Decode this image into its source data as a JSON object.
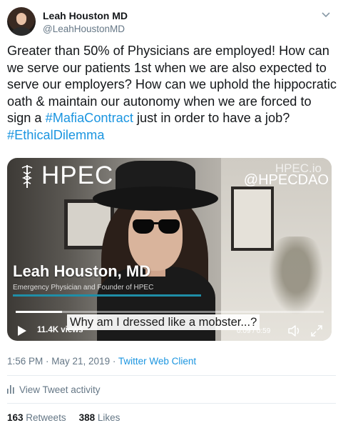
{
  "user": {
    "display_name": "Leah Houston MD",
    "handle": "@LeahHoustonMD",
    "avatar_icon": "avatar-photo"
  },
  "tweet": {
    "text_1": "Greater than 50% of Physicians are employed! How can we serve our patients 1st when we are also expected to serve our employers? How can we uphold the hippocratic oath & maintain our autonomy when we are forced to sign a ",
    "hashtag_1": "#MafiaContract",
    "text_2": " just in order to have a job? ",
    "hashtag_2": "#EthicalDilemma"
  },
  "video": {
    "brand": "HPEC",
    "watermark_site": "HPEC.io",
    "watermark_handle": "@HPECDAO",
    "lower_third_name": "Leah Houston, MD",
    "lower_third_subtitle": "Emergency Physician and Founder of HPEC",
    "caption": "Why am I dressed like a mobster...?",
    "views": "11.4K views",
    "time": "0:09 / 0:59",
    "progress": 0.15,
    "colors": {
      "accent_line": "#1f8ea7"
    }
  },
  "meta": {
    "timestamp": "1:56 PM · May 21, 2019 · ",
    "source": "Twitter Web Client"
  },
  "activity": {
    "label": "View Tweet activity"
  },
  "stats": {
    "retweets_count": "163",
    "retweets_label": "Retweets",
    "likes_count": "388",
    "likes_label": "Likes"
  },
  "colors": {
    "link": "#1b95e0",
    "secondary_text": "#657786",
    "primary_text": "#14171a"
  }
}
